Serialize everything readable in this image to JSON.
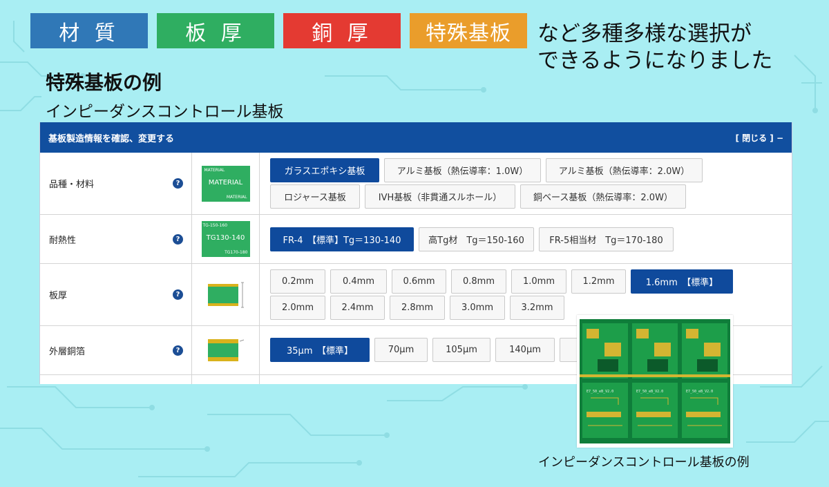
{
  "categories": [
    "材 質",
    "板 厚",
    "銅 厚",
    "特殊基板"
  ],
  "headline": {
    "line1": "など多種多様な選択が",
    "line2": "できるようになりました"
  },
  "section": {
    "title": "特殊基板の例",
    "subtitle": "インピーダンスコントロール基板"
  },
  "panel": {
    "header_title": "基板製造情報を確認、変更する",
    "close_label": "[ 閉じる ] −",
    "help_label": "?",
    "rows": [
      {
        "label": "品種・材料",
        "thumb": {
          "line1": "MATERIAL",
          "line2": "MATERIAL",
          "line3": "MATERIAL"
        },
        "options": [
          [
            "ガラスエポキシ基板",
            "アルミ基板（熱伝導率：1.0W）",
            "アルミ基板（熱伝導率：2.0W）"
          ],
          [
            "ロジャース基板",
            "IVH基板（非貫通スルホール）",
            "銅ベース基板（熱伝導率：2.0W）"
          ]
        ],
        "selected": "ガラスエポキシ基板"
      },
      {
        "label": "耐熱性",
        "thumb": {
          "line1": "TG-150-160",
          "line2": "TG130-140",
          "line3": "TG170-180"
        },
        "options": [
          [
            "FR-4　【標準】Tg＝130-140",
            "高Tg材　Tg＝150-160",
            "FR-5相当材　Tg＝170-180"
          ]
        ],
        "selected": "FR-4　【標準】Tg＝130-140"
      },
      {
        "label": "板厚",
        "options": [
          [
            "0.2mm",
            "0.4mm",
            "0.6mm",
            "0.8mm",
            "1.0mm",
            "1.2mm",
            "1.6mm　【標準】"
          ],
          [
            "2.0mm",
            "2.4mm",
            "2.8mm",
            "3.0mm",
            "3.2mm"
          ]
        ],
        "selected": "1.6mm　【標準】"
      },
      {
        "label": "外層銅箔",
        "options": [
          [
            "35μm　【標準】",
            "70μm",
            "105μm",
            "140μm",
            "1"
          ]
        ],
        "selected": "35μm　【標準】"
      }
    ]
  },
  "photo": {
    "caption": "インピーダンスコントロール基板の例",
    "board_label": "E7_50_eB_V2.0"
  },
  "colors": {
    "background": "#a9eef3",
    "blue": "#3078b7",
    "green": "#2fae61",
    "red": "#e43a32",
    "orange": "#ea9d2b",
    "navy": "#114f9f"
  }
}
